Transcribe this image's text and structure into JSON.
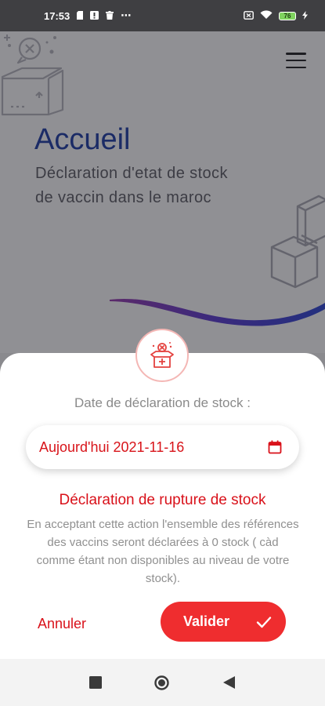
{
  "status_bar": {
    "time": "17:53",
    "left_icons": [
      "sim-card-icon",
      "notification-icon",
      "trash-icon",
      "more-dots-icon"
    ],
    "more": "⋯",
    "right_icons": [
      "screen-record-icon",
      "wifi-icon",
      "battery-icon"
    ],
    "battery": "76"
  },
  "header": {
    "title": "Accueil",
    "subtitle": "Déclaration d'etat de stock de vaccin dans le maroc",
    "menu_icon": "hamburger-menu-icon"
  },
  "dialog": {
    "badge_icon": "vaccine-box-icon",
    "date_label": "Date de déclaration de stock :",
    "date_value": "Aujourd'hui 2021-11-16",
    "calendar_icon": "calendar-icon",
    "warning_title": "Déclaration de rupture de stock",
    "warning_body": "En acceptant cette action l'ensemble des références des vaccins seront déclarées à 0 stock ( càd comme étant non disponibles au niveau de votre stock).",
    "cancel_label": "Annuler",
    "validate_label": "Valider",
    "validate_icon": "checkmark-icon"
  },
  "nav_bar": {
    "buttons": [
      "recents-square-icon",
      "home-circle-icon",
      "back-triangle-icon"
    ]
  },
  "colors": {
    "accent_red": "#ef2d2f",
    "text_red": "#d9111a",
    "title_blue": "#1b2b66",
    "overlay_gray": "#909094"
  }
}
